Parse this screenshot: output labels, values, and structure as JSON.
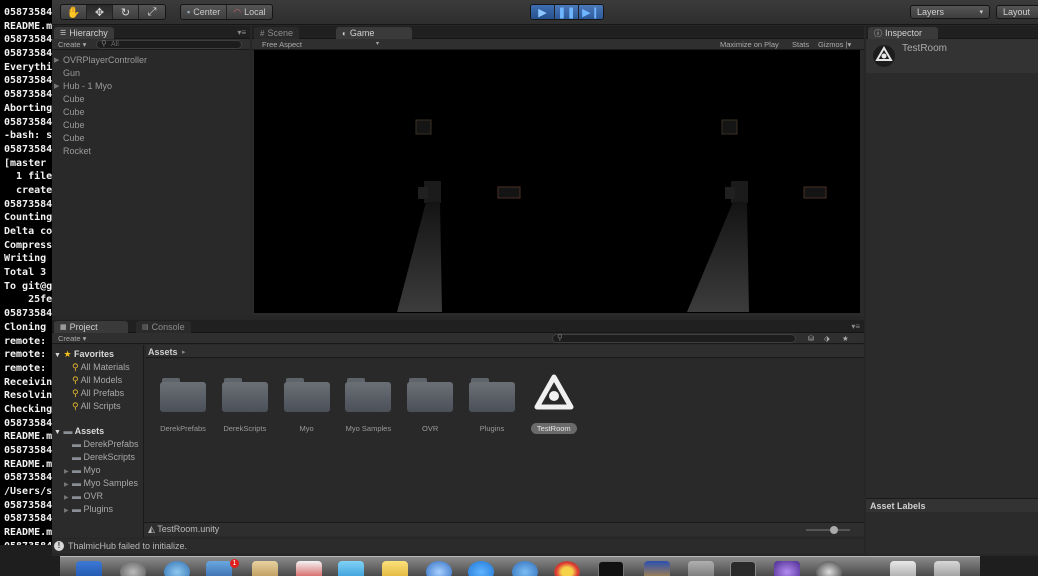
{
  "terminal": {
    "lines": [
      "05873584",
      "README.m",
      "05873584",
      "05873584",
      "Everythi",
      "05873584",
      "05873584",
      "Aborting",
      "05873584",
      "-bash: s",
      "05873584",
      "[master ",
      "  1 file",
      "  create ",
      "05873584",
      "Counting",
      "Delta co",
      "Compress",
      "Writing ",
      "Total 3 ",
      "To git@g",
      "    25fed",
      "05873584",
      "Cloning ",
      "remote: ",
      "remote: ",
      "remote: ",
      "Receivin",
      "Resolvin",
      "Checking",
      "05873584",
      "README.m",
      "05873584",
      "README.m",
      "05873584",
      "/Users/s",
      "05873584",
      "05873584",
      "README.m",
      "05873584"
    ]
  },
  "toolbar": {
    "hand_icon": "hand-icon",
    "move_icon": "move-icon",
    "rotate_icon": "rotate-icon",
    "scale_icon": "scale-icon",
    "pivot_center": "Center",
    "pivot_local": "Local",
    "play_icon": "play-icon",
    "pause_icon": "pause-icon",
    "step_icon": "step-icon",
    "layers_label": "Layers",
    "layout_label": "Layout"
  },
  "hierarchy": {
    "tab_label": "Hierarchy",
    "create_label": "Create",
    "search_placeholder": "All",
    "items": [
      {
        "label": "OVRPlayerController",
        "expandable": true
      },
      {
        "label": "Gun",
        "expandable": false
      },
      {
        "label": "Hub - 1 Myo",
        "expandable": true
      },
      {
        "label": "Cube",
        "expandable": false
      },
      {
        "label": "Cube",
        "expandable": false
      },
      {
        "label": "Cube",
        "expandable": false
      },
      {
        "label": "Cube",
        "expandable": false
      },
      {
        "label": "Rocket",
        "expandable": false
      }
    ]
  },
  "scene_tabs": {
    "scene_label": "Scene",
    "game_label": "Game",
    "aspect_label": "Free Aspect",
    "maximize_label": "Maximize on Play",
    "stats_label": "Stats",
    "gizmos_label": "Gizmos"
  },
  "project": {
    "project_tab": "Project",
    "console_tab": "Console",
    "create_label": "Create",
    "favorites_label": "Favorites",
    "favorites": [
      "All Materials",
      "All Models",
      "All Prefabs",
      "All Scripts"
    ],
    "assets_label": "Assets",
    "asset_tree": [
      "DerekPrefabs",
      "DerekScripts",
      "Myo",
      "Myo Samples",
      "OVR",
      "Plugins"
    ],
    "breadcrumb": "Assets",
    "grid_items": [
      {
        "label": "DerekPrefabs",
        "kind": "folder"
      },
      {
        "label": "DerekScripts",
        "kind": "folder"
      },
      {
        "label": "Myo",
        "kind": "folder"
      },
      {
        "label": "Myo Samples",
        "kind": "folder"
      },
      {
        "label": "OVR",
        "kind": "folder"
      },
      {
        "label": "Plugins",
        "kind": "folder"
      },
      {
        "label": "TestRoom",
        "kind": "unity-scene"
      }
    ],
    "selected_path": "TestRoom.unity"
  },
  "inspector": {
    "tab_label": "Inspector",
    "object_name": "TestRoom",
    "asset_labels": "Asset Labels"
  },
  "status": {
    "message": "ThalmicHub failed to initialize."
  },
  "dock": {
    "badge_count": "1"
  }
}
